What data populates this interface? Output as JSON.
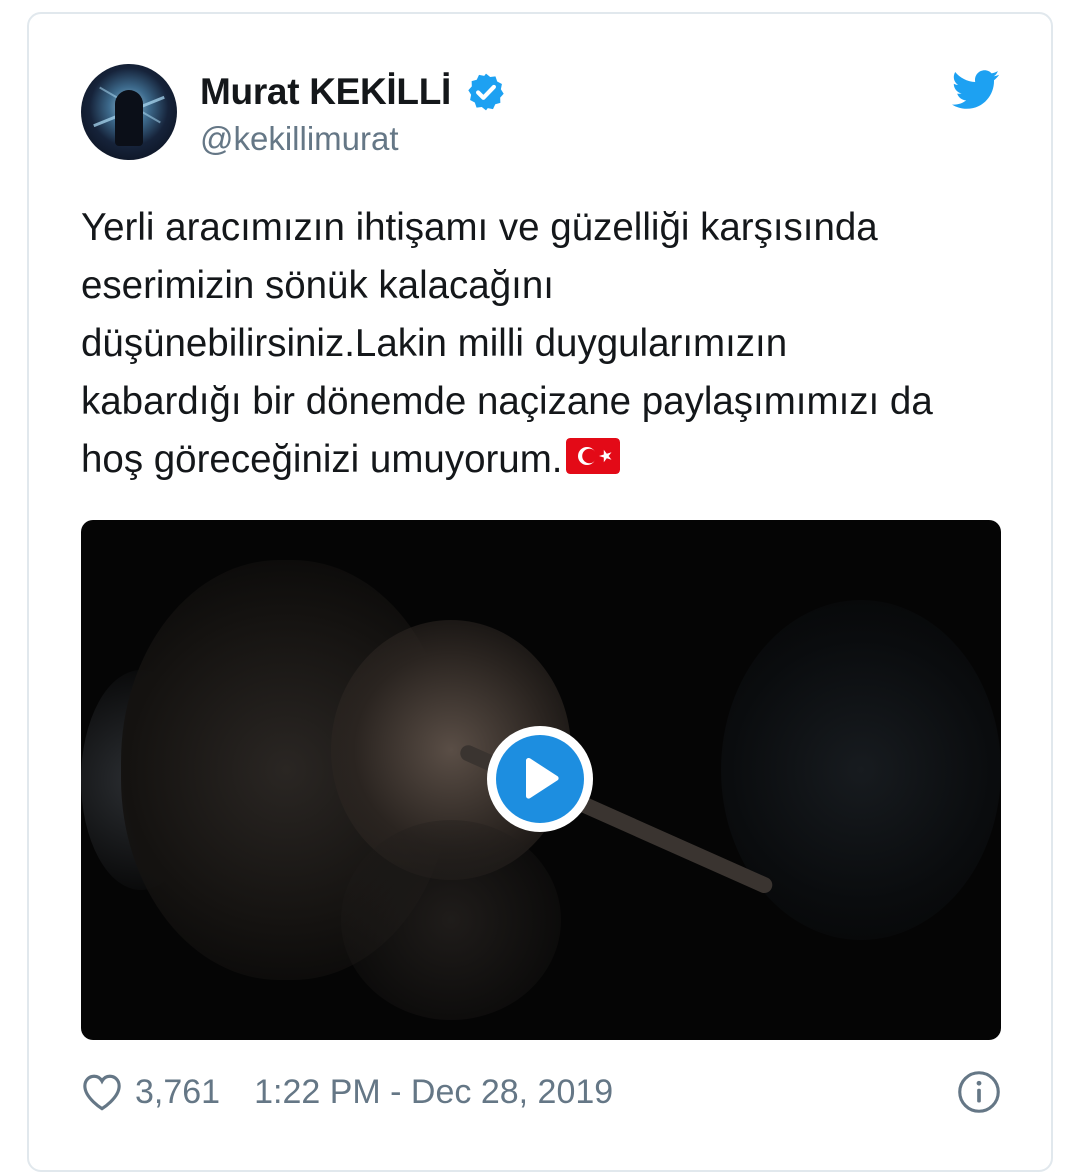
{
  "user": {
    "display_name": "Murat KEKİLLİ",
    "handle": "@kekillimurat",
    "verified": true
  },
  "tweet": {
    "text": "Yerli aracımızın ihtişamı ve güzelliği karşısında\neserimizin sönük kalacağını\ndüşünebilirsiniz.Lakin milli duygularımızın\nkabardığı bir dönemde naçizane paylaşımımızı da\nhoş göreceğinizi umuyorum.",
    "emoji": "turkish-flag-icon"
  },
  "media": {
    "type": "video",
    "play_icon": "play-icon"
  },
  "footer": {
    "like_count": "3,761",
    "timestamp": "1:22 PM - Dec 28, 2019"
  },
  "colors": {
    "brand": "#1da1f2",
    "text": "#14171a",
    "secondary": "#657786",
    "border": "#e1e8ed"
  }
}
